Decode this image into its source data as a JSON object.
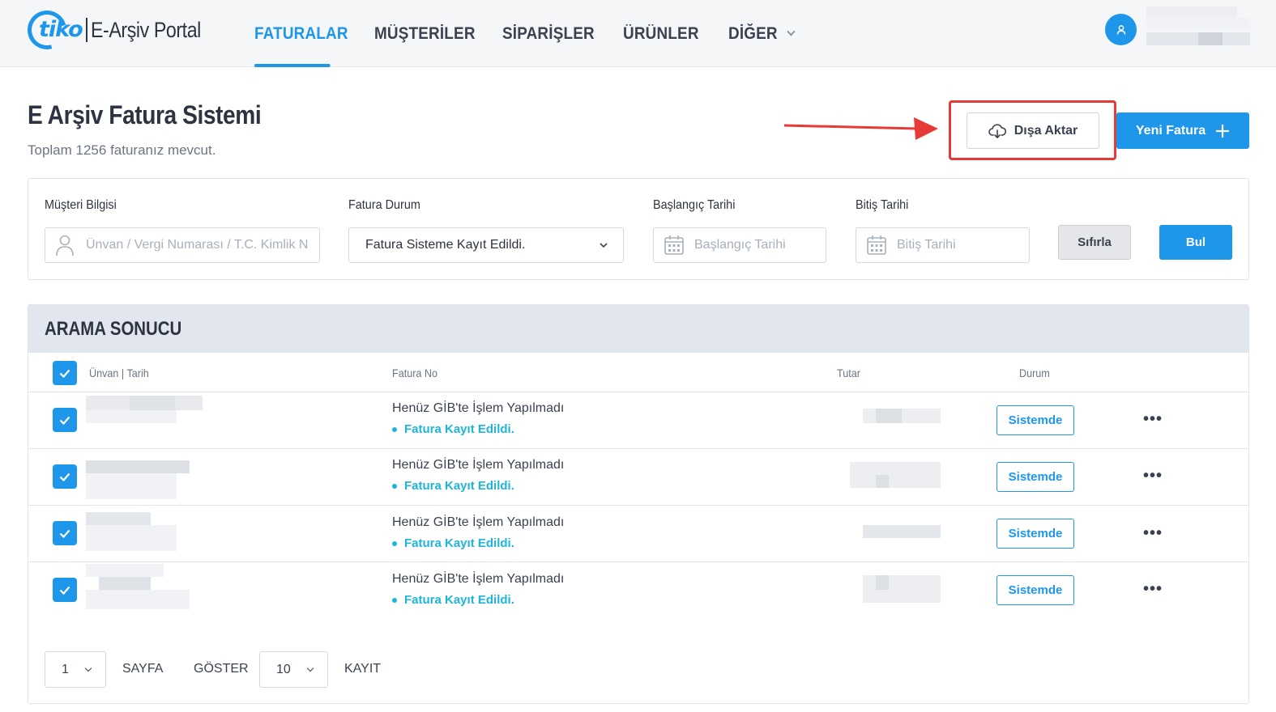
{
  "brand": {
    "logo_word": "tiko",
    "title": "E-Arşiv Portal"
  },
  "nav": {
    "items": [
      {
        "label": "FATURALAR",
        "active": true
      },
      {
        "label": "MÜŞTERİLER",
        "active": false
      },
      {
        "label": "SİPARİŞLER",
        "active": false
      },
      {
        "label": "ÜRÜNLER",
        "active": false
      },
      {
        "label": "DİĞER",
        "active": false,
        "has_dropdown": true
      }
    ]
  },
  "user": {
    "avatar_icon": "user-icon",
    "name": ""
  },
  "header": {
    "title": "E Arşiv Fatura Sistemi",
    "subtitle": "Toplam 1256 faturanız mevcut.",
    "export_label": "Dışa Aktar",
    "new_invoice_label": "Yeni Fatura"
  },
  "filters": {
    "customer": {
      "label": "Müşteri Bilgisi",
      "placeholder": "Ünvan / Vergi Numarası / T.C. Kimlik N"
    },
    "status": {
      "label": "Fatura Durum",
      "value": "Fatura Sisteme Kayıt Edildi."
    },
    "start_date": {
      "label": "Başlangıç Tarihi",
      "placeholder": "Başlangıç Tarihi"
    },
    "end_date": {
      "label": "Bitiş Tarihi",
      "placeholder": "Bitiş Tarihi"
    },
    "reset_label": "Sıfırla",
    "find_label": "Bul"
  },
  "results": {
    "title": "ARAMA SONUCU",
    "columns": {
      "name_date": "Ünvan | Tarih",
      "invoice_no": "Fatura No",
      "amount": "Tutar",
      "status": "Durum"
    },
    "rows": [
      {
        "checked": true,
        "gib_status": "Henüz GİB'te İşlem Yapılmadı",
        "record_status": "Fatura Kayıt Edildi.",
        "badge": "Sistemde"
      },
      {
        "checked": true,
        "gib_status": "Henüz GİB'te İşlem Yapılmadı",
        "record_status": "Fatura Kayıt Edildi.",
        "badge": "Sistemde"
      },
      {
        "checked": true,
        "gib_status": "Henüz GİB'te İşlem Yapılmadı",
        "record_status": "Fatura Kayıt Edildi.",
        "badge": "Sistemde"
      },
      {
        "checked": true,
        "gib_status": "Henüz GİB'te İşlem Yapılmadı",
        "record_status": "Fatura Kayıt Edildi.",
        "badge": "Sistemde"
      }
    ],
    "more_label": "•••"
  },
  "pagination": {
    "page": "1",
    "page_label": "SAYFA",
    "show_label": "GÖSTER",
    "per_page": "10",
    "records_label": "KAYIT"
  },
  "colors": {
    "accent": "#1e96ea",
    "teal": "#1eb6d8",
    "highlight": "#e53a35"
  }
}
